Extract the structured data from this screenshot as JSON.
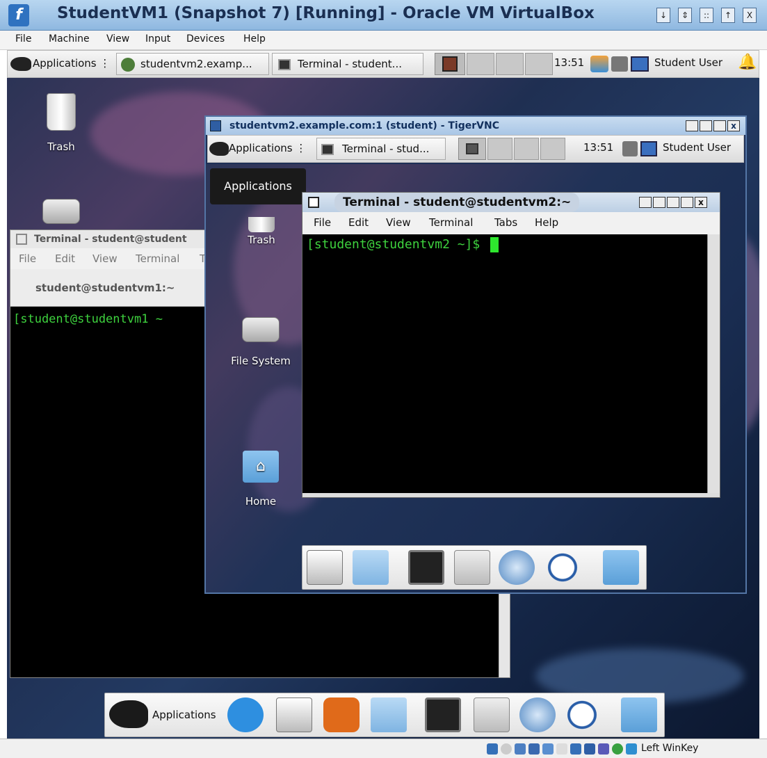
{
  "host": {
    "title": "StudentVM1 (Snapshot 7) [Running] - Oracle VM VirtualBox",
    "window_buttons": [
      "↓",
      "⇕",
      "::",
      "↑",
      "X"
    ],
    "menu": [
      "File",
      "Machine",
      "View",
      "Input",
      "Devices",
      "Help"
    ],
    "panel": {
      "apps": "Applications",
      "task1": "studentvm2.examp...",
      "task2": "Terminal - student...",
      "clock": "13:51",
      "user": "Student User"
    }
  },
  "desktop": {
    "trash": "Trash"
  },
  "term1": {
    "title": "Terminal - student@student",
    "menu": [
      "File",
      "Edit",
      "View",
      "Terminal",
      "T"
    ],
    "tab": "student@studentvm1:~",
    "prompt": "[student@studentvm1 ~"
  },
  "vnc": {
    "title": "studentvm2.example.com:1 (student) - TigerVNC",
    "panel": {
      "apps": "Applications",
      "task1": "Terminal - stud...",
      "clock": "13:51",
      "user": "Student User"
    },
    "apps_tooltip": "Applications",
    "icons": {
      "trash": "Trash",
      "filesystem": "File System",
      "home": "Home"
    }
  },
  "term2": {
    "title": "Terminal - student@studentvm2:~",
    "menu": [
      "File",
      "Edit",
      "View",
      "Terminal",
      "Tabs",
      "Help"
    ],
    "prompt": "[student@studentvm2 ~]$"
  },
  "dock": {
    "apps": "Applications"
  },
  "statusbar": {
    "hostkey": "Left WinKey"
  }
}
